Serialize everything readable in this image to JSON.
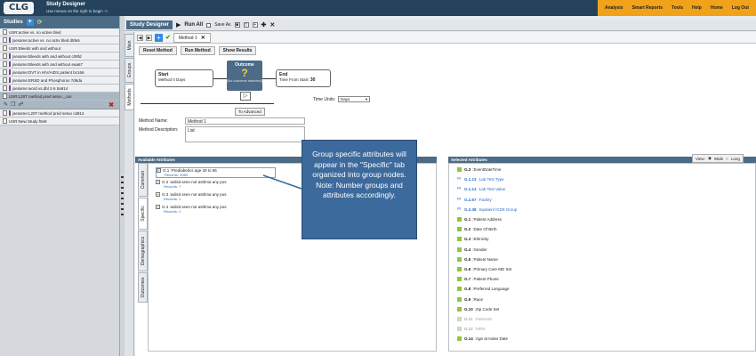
{
  "header": {
    "logo": "CLG",
    "app_title": "Study Designer",
    "app_subtitle": "Use menus on the right to begin ->",
    "nav": [
      "Analysis",
      "Smart Reports",
      "Tools",
      "Help",
      "Home",
      "Log Out"
    ]
  },
  "sidebar": {
    "title": "Studies",
    "add": "+",
    "studies": [
      "USR:active vs. no active bled",
      "jsesame:active vs. no activ bled d5fe5",
      "USR:Bleeds with and without",
      "jsesame:Bleeds with and without c08fd",
      "jsesame:Bleeds with and without eaa67",
      "jsesame:DVT in HIV/AIDS patient bc166",
      "jsesame:ERSD and Phosphorus 7d6da",
      "jsesame:word vs.dbl 2-5 5a914",
      "USR:L20T method pred setoo _cus",
      "jsesame:L20T method pred setoo cd914",
      "USR:New Study f0e8"
    ],
    "selected_index": 8
  },
  "designer": {
    "title": "Study Designer",
    "run_all": "Run All",
    "save_as": "Save As",
    "side_tabs": [
      "Main",
      "Groups",
      "Methods"
    ],
    "method_tab": "Method 1",
    "actions": [
      "Reset Method",
      "Run Method",
      "Show Results"
    ],
    "flow": {
      "start_label": "Start",
      "start_detail": "Method 0 Days",
      "outcome_title": "Outcome",
      "outcome_mark": "?",
      "outcome_note": "[No outcome selected]",
      "end_label": "End",
      "end_detail": "Time From Start:",
      "end_value": "30",
      "time_units_label": "Time Units:",
      "time_units_value": "Days",
      "advanced": "To Advanced"
    },
    "method_name_label": "Method Name:",
    "method_name_value": "Method 1",
    "method_desc_label": "Method Description:",
    "method_desc_value": "List"
  },
  "available": {
    "title": "Available Attributes",
    "tabs": [
      "Common",
      "Specific",
      "Demographics",
      "Outcomes"
    ],
    "rows": [
      {
        "label": "G.1 :Prediabetics age 40 to 65",
        "sub": "Records: 3983"
      },
      {
        "label": "G.2 :wdisit seen not asthma any pos",
        "sub": "Records: 7"
      },
      {
        "label": "G.3 :wdisit seen not asthma any pos",
        "sub": "Records: 1"
      },
      {
        "label": "G.4 :wdisit seen not asthma any pos",
        "sub": "Records: 1"
      }
    ]
  },
  "callout": {
    "text": "Group specific attributes will appear in the \"Specific\" tab organized into group nodes. Note: Number groups and attributes accordingly."
  },
  "selected": {
    "title": "Selected Attributes",
    "view_label": "View:",
    "view_wide": "Wide",
    "view_long": "Long",
    "rows": [
      {
        "code": "G.3",
        "label": ":EventDateTime",
        "style": "plain"
      },
      {
        "code": "G.1.13",
        "label": ":Lab Test Type",
        "style": "blue"
      },
      {
        "code": "G.1.14",
        "label": ":Lab Test Value",
        "style": "blue"
      },
      {
        "code": "G.2.57",
        "label": ":Facility",
        "style": "blue"
      },
      {
        "code": "G.2.38",
        "label": ":Inpatient ICD9 Group",
        "style": "blue"
      },
      {
        "code": "G.1",
        "label": ":Patient Address",
        "style": "plain"
      },
      {
        "code": "G.2",
        "label": ":Date Of Birth",
        "style": "plain"
      },
      {
        "code": "G.3",
        "label": ":Ethnicity",
        "style": "plain"
      },
      {
        "code": "G.4",
        "label": ":Gender",
        "style": "plain"
      },
      {
        "code": "G.5",
        "label": ":Patient Name",
        "style": "plain"
      },
      {
        "code": "G.6",
        "label": ":Primary Care MD Set",
        "style": "plain"
      },
      {
        "code": "G.7",
        "label": ":Patient Phone",
        "style": "plain"
      },
      {
        "code": "G.8",
        "label": ":Preferred Language",
        "style": "plain"
      },
      {
        "code": "G.9",
        "label": ":Race",
        "style": "plain"
      },
      {
        "code": "G.10",
        "label": ":Zip Code Set",
        "style": "plain"
      },
      {
        "code": "G.11",
        "label": ":PatientID",
        "style": "dim"
      },
      {
        "code": "G.12",
        "label": ":MRN",
        "style": "dim"
      },
      {
        "code": "G.14",
        "label": ":Age at Index Date",
        "style": "plain"
      }
    ]
  },
  "colors": {
    "header": "#24425c",
    "nav": "#f0a21b",
    "accent": "#4b6b86",
    "callout": "#3d6a9c",
    "attr_icon": "#8dc63f",
    "link_blue": "#2a6cc9"
  }
}
